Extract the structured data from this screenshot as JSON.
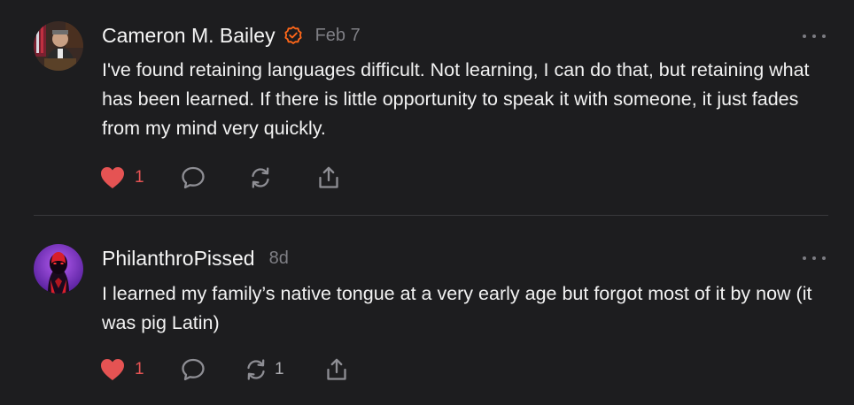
{
  "comments": [
    {
      "author": "Cameron M. Bailey",
      "verified_icon": "verified-badge-icon",
      "date": "Feb 7",
      "text": "I've found retaining languages difficult. Not learning, I can do that, but retaining what has been learned. If there is little opportunity to speak it with someone, it just fades from my mind very quickly.",
      "likes": "1",
      "restacks": ""
    },
    {
      "author": "PhilanthroPissed",
      "date": "8d",
      "text": "I learned my family’s native tongue at a very early age but forgot most of it by now (it was pig Latin)",
      "likes": "1",
      "restacks": "1"
    }
  ],
  "colors": {
    "background": "#1d1d1f",
    "like_red": "#e55353",
    "verified_orange": "#ff6719",
    "muted_text": "#7f7f85",
    "divider": "#38383c"
  }
}
